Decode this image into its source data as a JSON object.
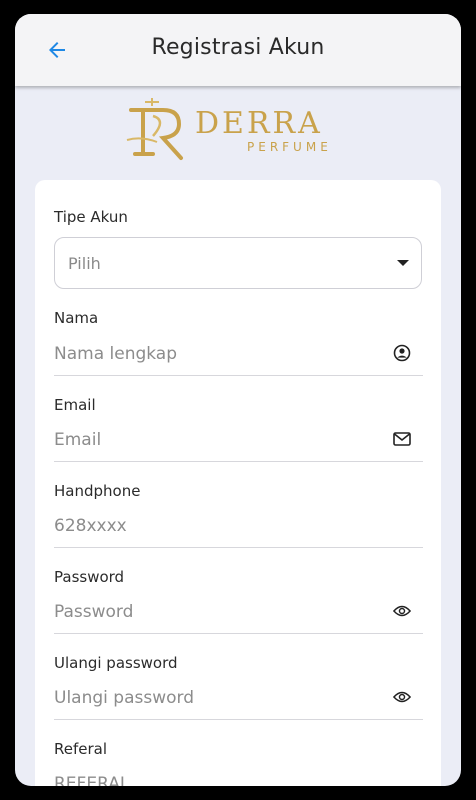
{
  "header": {
    "title": "Registrasi Akun"
  },
  "logo": {
    "word": "DERRA",
    "sub": "PERFUME"
  },
  "form": {
    "account_type": {
      "label": "Tipe Akun",
      "value": "Pilih"
    },
    "name": {
      "label": "Nama",
      "placeholder": "Nama lengkap"
    },
    "email": {
      "label": "Email",
      "placeholder": "Email"
    },
    "phone": {
      "label": "Handphone",
      "placeholder": "628xxxx"
    },
    "password": {
      "label": "Password",
      "placeholder": "Password"
    },
    "repeat_password": {
      "label": "Ulangi password",
      "placeholder": "Ulangi password"
    },
    "referral": {
      "label": "Referal",
      "placeholder": "REFERAL"
    }
  },
  "colors": {
    "accent": "#1e88e5",
    "brand_gold": "#c9a24b",
    "background": "#ebedf6"
  },
  "icons": {
    "back": "arrow-left-icon",
    "name": "user-circle-icon",
    "email": "mail-icon",
    "password": "eye-icon",
    "repeat_password": "eye-icon",
    "dropdown": "caret-down-icon"
  }
}
